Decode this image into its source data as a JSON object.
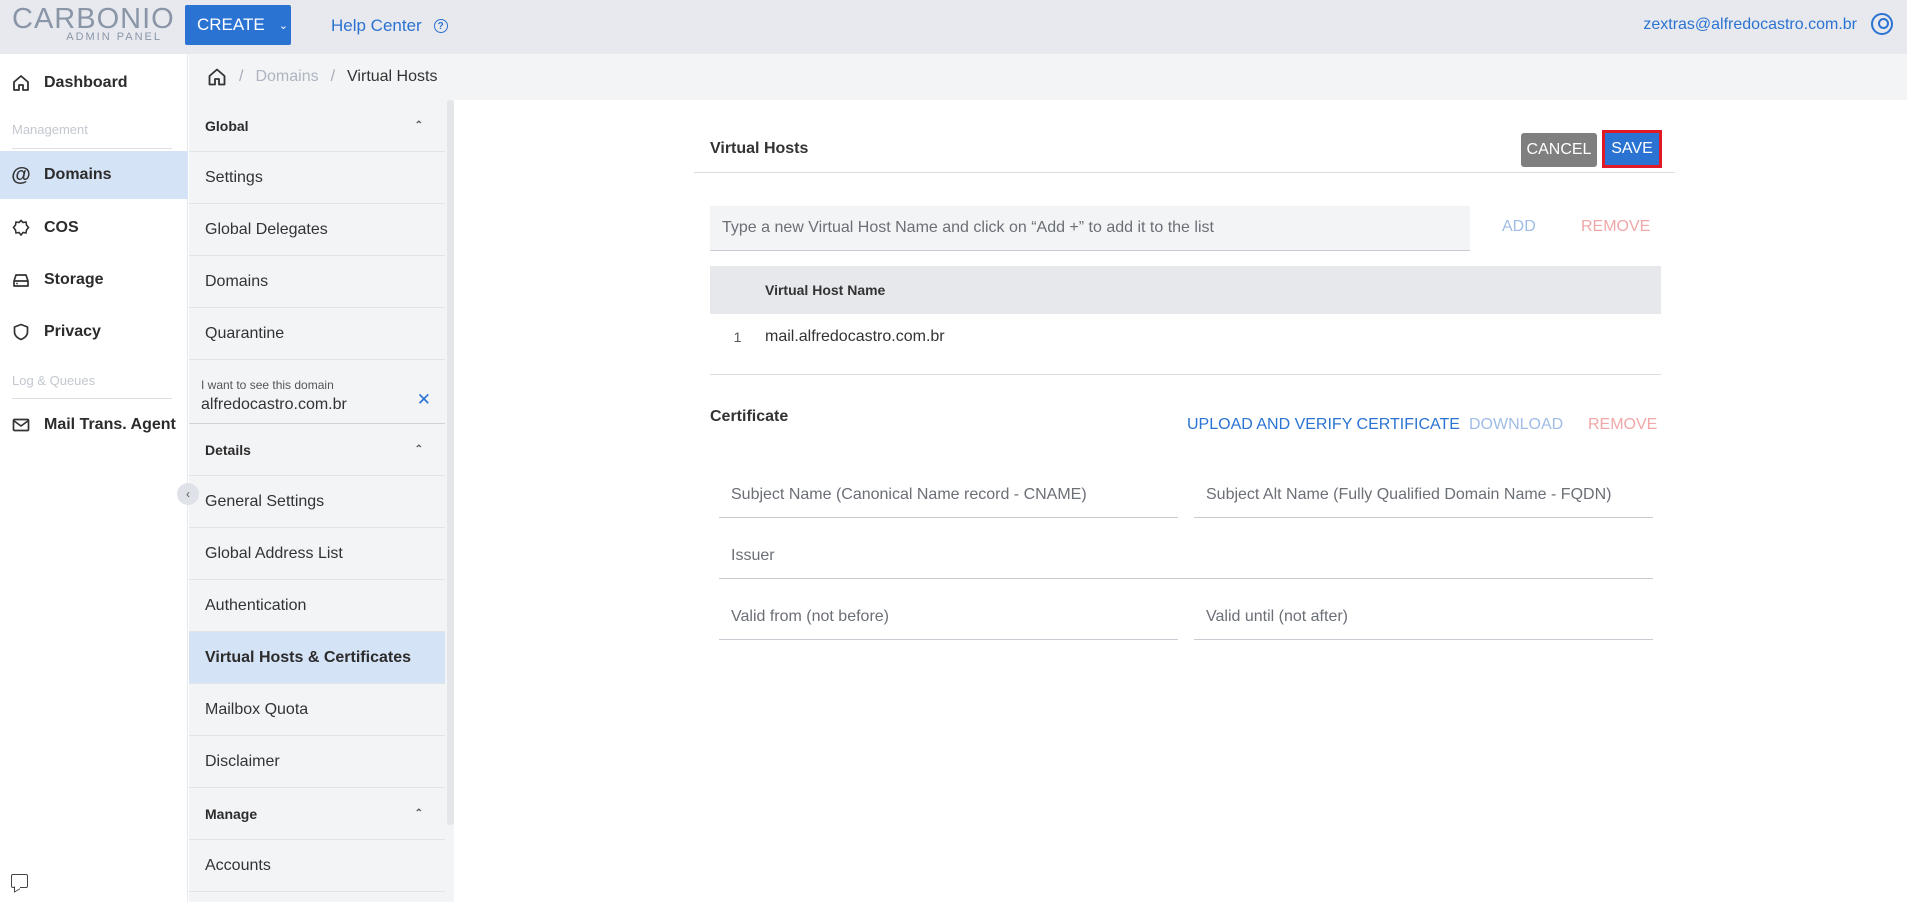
{
  "topbar": {
    "logo_main": "CARBONIO",
    "logo_sub": "ADMIN PANEL",
    "create_label": "CREATE",
    "help_label": "Help Center",
    "user_email": "zextras@alfredocastro.com.br"
  },
  "leftnav": {
    "dashboard": "Dashboard",
    "section_management": "Management",
    "domains": "Domains",
    "cos": "COS",
    "storage": "Storage",
    "privacy": "Privacy",
    "section_log": "Log & Queues",
    "mta": "Mail Trans. Agent"
  },
  "breadcrumb": {
    "domains": "Domains",
    "current": "Virtual Hosts"
  },
  "subnav": {
    "global_header": "Global",
    "global_items": [
      "Settings",
      "Global Delegates",
      "Domains",
      "Quarantine"
    ],
    "domain_filter_label": "I want to see this domain",
    "domain_filter_value": "alfredocastro.com.br",
    "details_header": "Details",
    "details_items": [
      "General Settings",
      "Global Address List",
      "Authentication",
      "Virtual Hosts & Certificates",
      "Mailbox Quota",
      "Disclaimer"
    ],
    "manage_header": "Manage",
    "manage_items": [
      "Accounts"
    ]
  },
  "main": {
    "vh_title": "Virtual Hosts",
    "cancel_label": "CANCEL",
    "save_label": "SAVE",
    "vh_placeholder": "Type a new Virtual Host Name and click on “Add +” to add it to the list",
    "add_label": "ADD",
    "remove_label": "REMOVE",
    "table_header": "Virtual Host Name",
    "rows": [
      {
        "num": "1",
        "name": "mail.alfredocastro.com.br"
      }
    ],
    "cert_title": "Certificate",
    "upload_label": "UPLOAD AND VERIFY CERTIFICATE",
    "download_label": "DOWNLOAD",
    "cert_remove_label": "REMOVE",
    "fields": {
      "subject_name": "Subject Name (Canonical Name record - CNAME)",
      "subject_alt": "Subject Alt Name (Fully Qualified Domain Name - FQDN)",
      "issuer": "Issuer",
      "valid_from": "Valid from (not before)",
      "valid_until": "Valid until (not after)"
    }
  },
  "colors": {
    "accent": "#2b73d2",
    "save_highlight": "#e01a26",
    "active_bg": "#d5e3f6",
    "remove": "#f0a7a8"
  }
}
